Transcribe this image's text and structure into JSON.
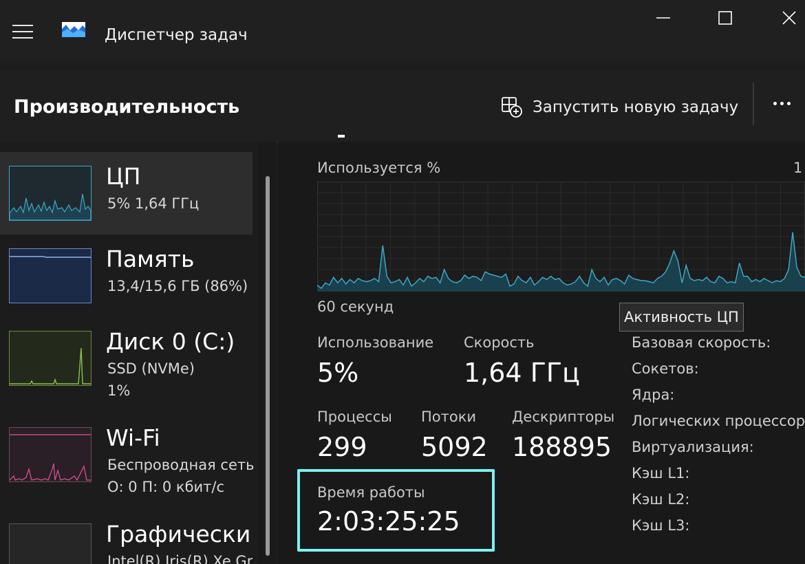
{
  "window": {
    "title": "Диспетчер задач",
    "controls": [
      "minimize",
      "maximize",
      "close"
    ]
  },
  "header": {
    "section_title": "Производительность",
    "new_task_label": "Запустить новую задачу",
    "more_icon": "more-icon"
  },
  "sidebar": {
    "items": [
      {
        "title": "ЦП",
        "line1": "5%  1,64 ГГц",
        "line2": ""
      },
      {
        "title": "Память",
        "line1": "13,4/15,6 ГБ (86%)",
        "line2": ""
      },
      {
        "title": "Диск 0 (C:)",
        "line1": "SSD (NVMe)",
        "line2": "1%"
      },
      {
        "title": "Wi-Fi",
        "line1": "Беспроводная сеть",
        "line2": "О: 0  П: 0 кбит/с"
      },
      {
        "title": "Графический",
        "line1": "Intel(R) Iris(R) Xe Gra",
        "line2": ""
      }
    ]
  },
  "main": {
    "graph_label": "Используется %",
    "graph_right_label": "1",
    "graph_time_label": "60 секунд",
    "tooltip": "Активность ЦП",
    "graph_values": [
      6,
      3,
      8,
      6,
      13,
      8,
      12,
      7,
      11,
      8,
      12,
      10,
      9,
      10,
      12,
      9,
      42,
      14,
      8,
      9,
      11,
      6,
      13,
      5,
      8,
      12,
      9,
      14,
      12,
      13,
      8,
      20,
      12,
      9,
      8,
      10,
      15,
      12,
      14,
      13,
      10,
      18,
      16,
      15,
      14,
      13,
      16,
      5,
      7,
      14,
      10,
      8,
      13,
      6,
      9,
      13,
      11,
      14,
      11,
      12,
      8,
      6,
      7,
      9,
      14,
      8,
      5,
      20,
      12,
      9,
      13,
      6,
      11,
      12,
      10,
      7,
      15,
      12,
      11,
      10,
      10,
      9,
      8,
      12,
      14,
      18,
      26,
      37,
      28,
      8,
      24,
      12,
      10,
      11,
      10,
      13,
      9,
      8,
      14,
      12,
      8,
      9,
      8,
      26,
      14,
      14,
      9,
      11,
      9,
      12,
      10,
      8,
      10,
      9,
      12,
      20,
      54,
      22,
      14,
      13
    ],
    "stats": {
      "usage_label": "Использование",
      "usage_value": "5%",
      "speed_label": "Скорость",
      "speed_value": "1,64 ГГц",
      "processes_label": "Процессы",
      "processes_value": "299",
      "threads_label": "Потоки",
      "threads_value": "5092",
      "handles_label": "Дескрипторы",
      "handles_value": "188895",
      "uptime_label": "Время работы",
      "uptime_value": "2:03:25:25"
    },
    "specs": [
      "Базовая скорость:",
      "Сокетов:",
      "Ядра:",
      "Логических процессоров:",
      "Виртуализация:",
      "Кэш L1:",
      "Кэш L2:",
      "Кэш L3:"
    ]
  },
  "colors": {
    "cpu_line": "#3fa7c3",
    "memory_fill": "#1b2a46",
    "disk_line": "#8bc34a",
    "wifi_line": "#e0529a",
    "uptime_border": "#7ef0f2"
  }
}
